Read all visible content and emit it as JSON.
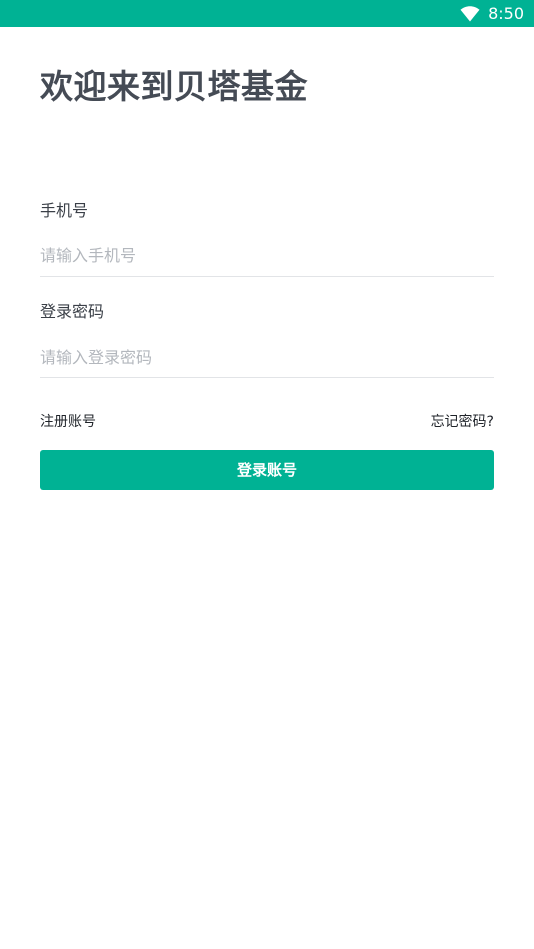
{
  "status_bar": {
    "time": "8:50",
    "icons": [
      "wifi-icon"
    ],
    "color": "#00b294"
  },
  "header": {
    "title": "欢迎来到贝塔基金"
  },
  "form": {
    "phone": {
      "label": "手机号",
      "placeholder": "请输入手机号",
      "value": ""
    },
    "password": {
      "label": "登录密码",
      "placeholder": "请输入登录密码",
      "value": ""
    }
  },
  "links": {
    "register": "注册账号",
    "forgot_password": "忘记密码?"
  },
  "actions": {
    "login_label": "登录账号",
    "accent_color": "#00b294"
  }
}
